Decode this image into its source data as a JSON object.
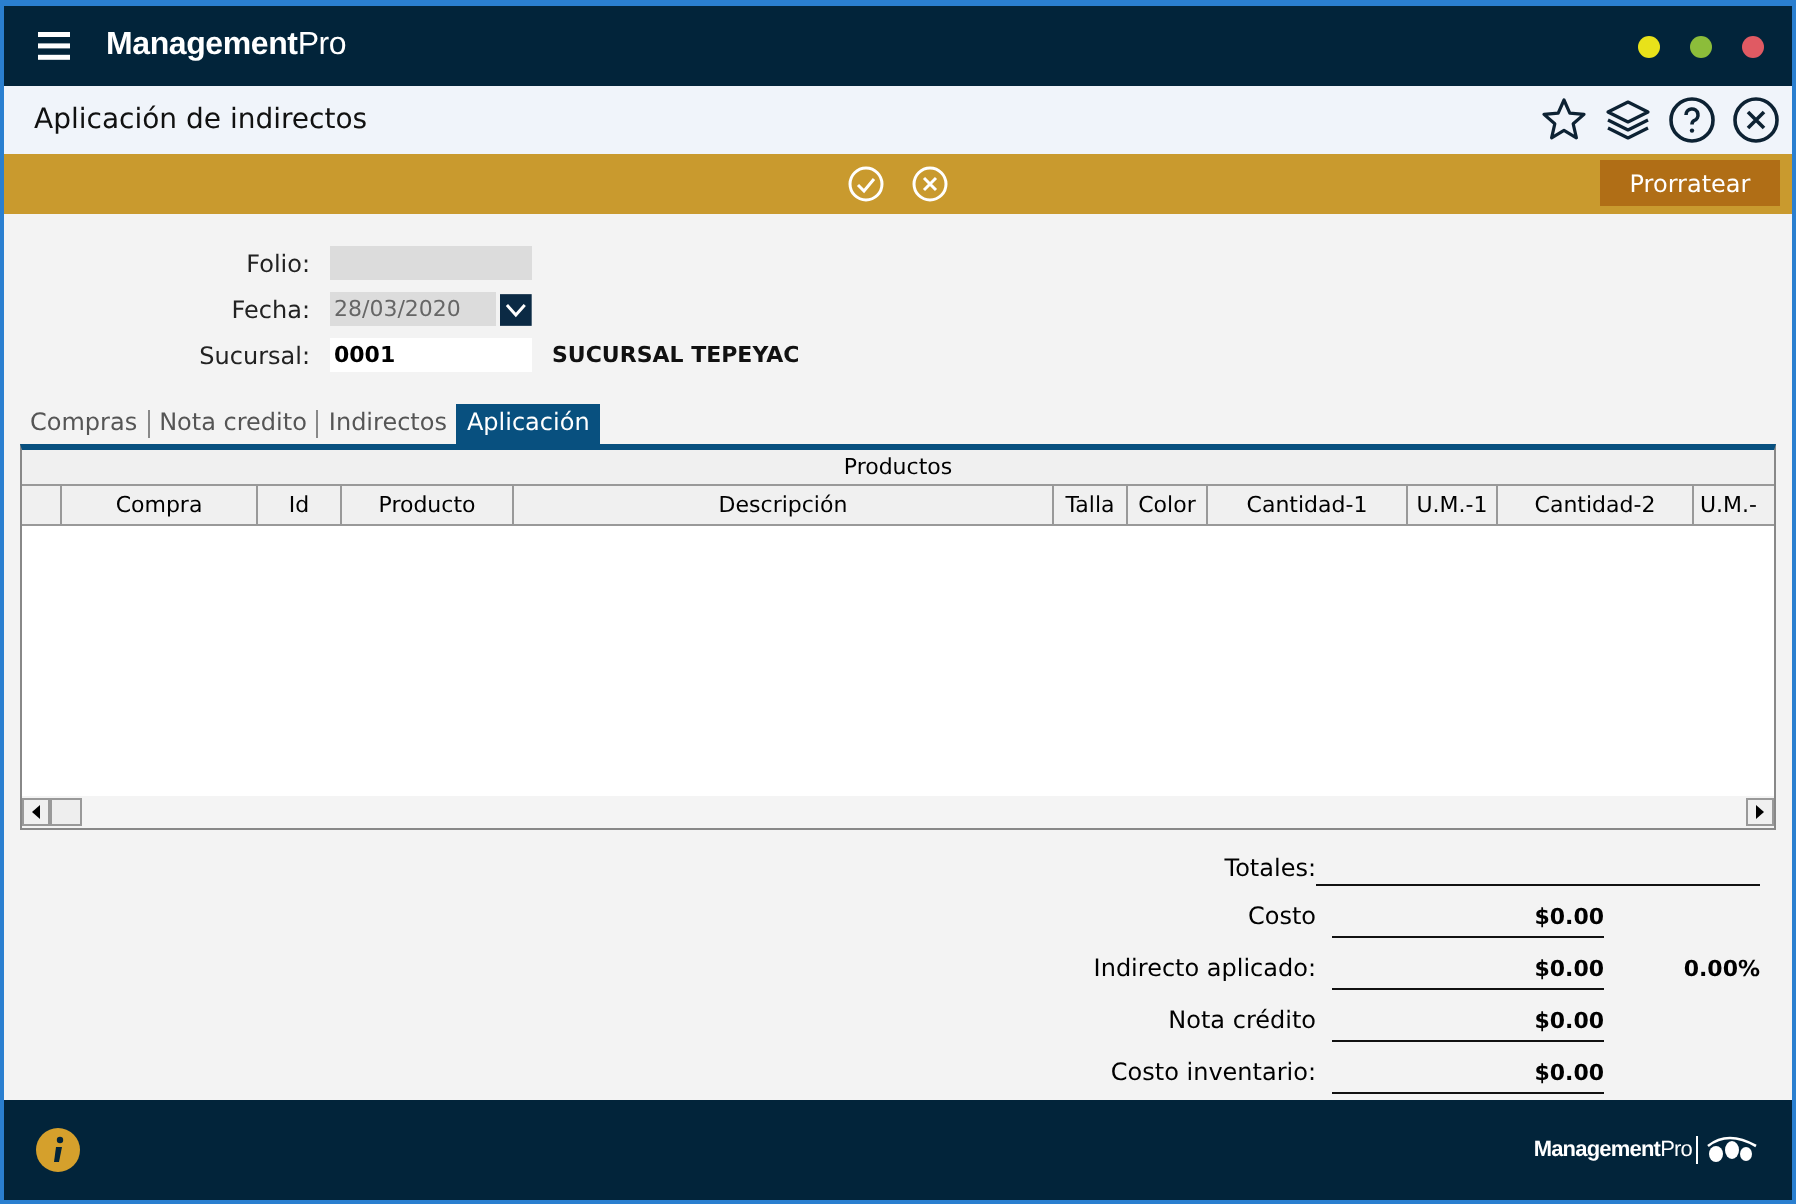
{
  "app": {
    "logo": "**Management**Pro"
  },
  "header": {
    "title": "Aplicación de indirectos"
  },
  "action_bar": {
    "button": "Prorratear"
  },
  "form": {
    "folio": {
      "label": "Folio:"
    },
    "fecha": {
      "label": "Fecha:",
      "value": "28/03/2020"
    },
    "sucursal": {
      "label": "Sucursal:",
      "value": "0001",
      "name": "SUCURSAL TEPEYAC"
    }
  },
  "tabs": [
    {
      "label": "Compras",
      "selected": false
    },
    {
      "label": "Nota credito",
      "selected": false
    },
    {
      "label": "Indirectos",
      "selected": false
    },
    {
      "label": "Aplicación",
      "selected": true
    }
  ],
  "table": {
    "group": "Productos",
    "columns": [
      "Compra",
      "Id",
      "Producto",
      "Descripción",
      "Talla",
      "Color",
      "Cantidad-1",
      "U.M.-1",
      "Cantidad-2",
      "U.M.-"
    ]
  },
  "totals": {
    "label": "Totales:",
    "rows": [
      {
        "label": "Costo",
        "value": "$0.00"
      },
      {
        "label": "Indirecto aplicado:",
        "value": "$0.00",
        "percent": "0.00%"
      },
      {
        "label": "Nota crédito",
        "value": "$0.00"
      },
      {
        "label": "Costo inventario:",
        "value": "$0.00"
      }
    ]
  },
  "footer": {
    "logo": "**Management**Pro"
  }
}
